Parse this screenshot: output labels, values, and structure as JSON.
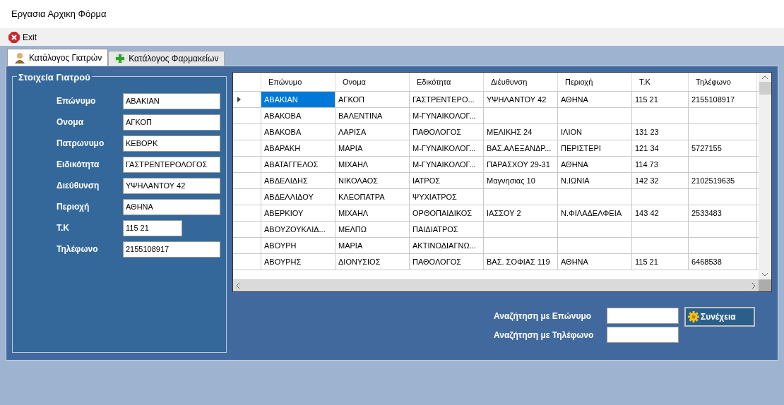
{
  "window": {
    "title": "Εργασια Αρχικη Φόρμα"
  },
  "menu": [
    {
      "label": "Exit",
      "kind": "exit"
    }
  ],
  "tabs": [
    {
      "label": "Κατάλογος Γιατρών",
      "selected": true,
      "kind": "doctor"
    },
    {
      "label": "Κατάλογος Φαρμακείων",
      "selected": false,
      "kind": "pharmacy"
    }
  ],
  "doctor_details": {
    "title": "Στοιχεία Γιατρού",
    "fields": [
      {
        "label": "Επώνυμο",
        "value": "ΑΒΑΚΙΑΝ",
        "kind": "wide"
      },
      {
        "label": "Ονομα",
        "value": "ΑΓΚΟΠ",
        "kind": "wide"
      },
      {
        "label": "Πατρωνυμο",
        "value": "ΚΕΒΟΡΚ",
        "kind": "wide"
      },
      {
        "label": "Ειδικότητα",
        "value": "ΓΑΣΤΡΕΝΤΕΡΟΛΟΓΟΣ",
        "kind": "wide"
      },
      {
        "label": "Διεύθυνση",
        "value": "ΥΨΗΛΑΝΤΟΥ 42",
        "kind": "wide"
      },
      {
        "label": "Περιοχή",
        "value": "ΑΘΗΝΑ",
        "kind": "wide"
      },
      {
        "label": "Τ.Κ",
        "value": "115 21",
        "kind": "short"
      },
      {
        "label": "Τηλέφωνο",
        "value": "2155108917",
        "kind": "wide"
      }
    ]
  },
  "table": {
    "columns": [
      "Επώνυμο",
      "Ονομα",
      "Εδικότητα",
      "Διέυθυνση",
      "Περιοχή",
      "Τ.Κ",
      "Τηλέφωνο"
    ],
    "rows": [
      {
        "selected": true,
        "cells": [
          "ΑΒΑΚΙΑΝ",
          "ΑΓΚΟΠ",
          "ΓΑΣΤΡΕΝΤΕΡΟ...",
          "ΥΨΗΛΑΝΤΟΥ 42",
          "ΑΘΗΝΑ",
          "115 21",
          "2155108917"
        ]
      },
      {
        "selected": false,
        "cells": [
          "ΑΒΑΚΟΒΑ",
          "ΒΑΛΕΝΤΙΝΑ",
          "Μ-ΓΥΝΑΙΚΟΛΟΓ...",
          "",
          "",
          "",
          ""
        ]
      },
      {
        "selected": false,
        "cells": [
          "ΑΒΑΚΟΒΑ",
          "ΛΑΡΙΣΑ",
          "ΠΑΘΟΛΟΓΟΣ",
          "ΜΕΛΙΚΗΣ 24",
          "ΙΛΙΟΝ",
          "131 23",
          ""
        ]
      },
      {
        "selected": false,
        "cells": [
          "ΑΒΑΡΑΚΗ",
          "ΜΑΡΙΑ",
          "Μ-ΓΥΝΑΙΚΟΛΟΓ...",
          "ΒΑΣ.ΑΛΕΞΑΝΔΡ...",
          "ΠΕΡΙΣΤΕΡΙ",
          "121 34",
          "5727155"
        ]
      },
      {
        "selected": false,
        "cells": [
          "ΑΒΑΤΑΓΓΕΛΟΣ",
          "ΜΙΧΑΗΛ",
          "Μ-ΓΥΝΑΙΚΟΛΟΓ...",
          "ΠΑΡΑΣΧΟΥ 29-31",
          "ΑΘΗΝΑ",
          "114 73",
          ""
        ]
      },
      {
        "selected": false,
        "cells": [
          "ΑΒΔΕΛΙΔΗΣ",
          "ΝΙΚΟΛΑΟΣ",
          "ΙΑΤΡΟΣ",
          "Μαγνησιας 10",
          "Ν.ΙΩΝΙΑ",
          "142 32",
          "2102519635"
        ]
      },
      {
        "selected": false,
        "cells": [
          "ΑΒΔΕΛΛΙΔΟΥ",
          "ΚΛΕΟΠΑΤΡΑ",
          "ΨΥΧΙΑΤΡΟΣ",
          "",
          "",
          "",
          ""
        ]
      },
      {
        "selected": false,
        "cells": [
          "ΑΒΕΡΚΙΟΥ",
          "ΜΙΧΑΗΛ",
          "ΟΡΘΟΠΑΙΔΙΚΟΣ",
          "ΙΑΣΣΟΥ 2",
          "Ν.ΦΙΛΑΔΕΛΦΕΙΑ",
          "143 42",
          "2533483"
        ]
      },
      {
        "selected": false,
        "cells": [
          "ΑΒΟΥΖΟΥΚΛΙΔ...",
          "ΜΕΛΠΩ",
          "ΠΑΙΔΙΑΤΡΟΣ",
          "",
          "",
          "",
          ""
        ]
      },
      {
        "selected": false,
        "cells": [
          "ΑΒΟΥΡΗ",
          "ΜΑΡΙΑ",
          "ΑΚΤΙΝΟΔΙΑΓΝΩ...",
          "",
          "",
          "",
          ""
        ]
      },
      {
        "selected": false,
        "cells": [
          "ΑΒΟΥΡΗΣ",
          "ΔΙΟΝΥΣΙΟΣ",
          "ΠΑΘΟΛΟΓΟΣ",
          "ΒΑΣ. ΣΟΦΙΑΣ 119",
          "ΑΘΗΝΑ",
          "115 21",
          "6468538"
        ]
      }
    ]
  },
  "search": {
    "fields": [
      {
        "label": "Αναζήτηση με Επώνυμο"
      },
      {
        "label": "Αναζήτηση με Τηλέφωνο"
      }
    ],
    "button": "Συνέχεια"
  }
}
